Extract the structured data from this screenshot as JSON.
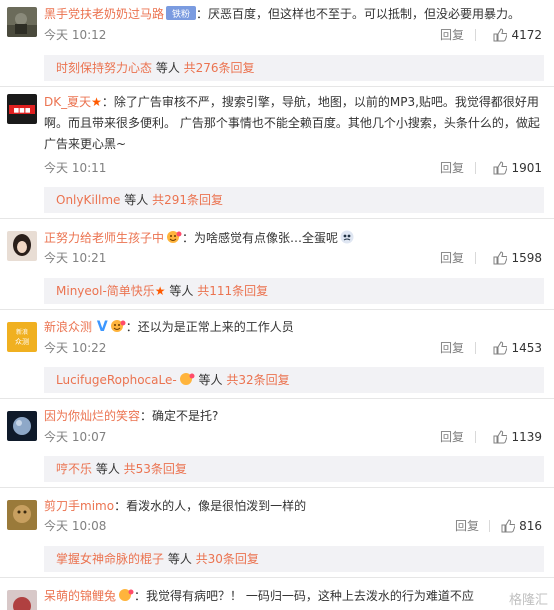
{
  "accent_color": "#eb7350",
  "comments": [
    {
      "username": "黑手党扶老奶奶过马路",
      "badge": "铁粉",
      "text": "：厌恶百度，但这样也不至于。可以抵制，但没必要用暴力。",
      "time": "今天 10:12",
      "reply_label": "回复",
      "likes": "4172",
      "sub_user": "时刻保持努力心态",
      "sub_mid": " 等人 ",
      "sub_total": "共276条回复"
    },
    {
      "username": "DK_夏天",
      "text": "：除了广告审核不严，搜索引擎，导航，地图，以前的MP3,贴吧。我觉得都很好用啊。而且带来很多便利。 广告那个事情也不能全赖百度。其他几个小搜索，头条什么的，做起广告来更心黑~",
      "time": "今天 10:11",
      "reply_label": "回复",
      "likes": "1901",
      "sub_user": "OnlyKillme",
      "sub_mid": " 等人 ",
      "sub_total": "共291条回复"
    },
    {
      "username": "正努力给老师生孩子中",
      "text": "：为啥感觉有点像张…全蛋呢",
      "time": "今天 10:21",
      "reply_label": "回复",
      "likes": "1598",
      "sub_user": "Minyeol-简单快乐",
      "sub_mid": " 等人 ",
      "sub_total": "共111条回复"
    },
    {
      "username": "新浪众测",
      "text": "：还以为是正常上来的工作人员",
      "time": "今天 10:22",
      "reply_label": "回复",
      "likes": "1453",
      "sub_user": "LucifugeRophocaLe-",
      "sub_mid": " 等人 ",
      "sub_total": "共32条回复"
    },
    {
      "username": "因为你灿烂的笑容",
      "text": "：确定不是托?",
      "time": "今天 10:07",
      "reply_label": "回复",
      "likes": "1139",
      "sub_user": "哼不乐",
      "sub_mid": " 等人 ",
      "sub_total": "共53条回复"
    },
    {
      "username": "剪刀手mimo",
      "text": "：看泼水的人，像是很怕泼到一样的",
      "time": "今天 10:08",
      "reply_label": "回复",
      "likes": "816",
      "sub_user": "掌握女神命脉的棍子",
      "sub_mid": " 等人 ",
      "sub_total": "共30条回复"
    },
    {
      "username": "呆萌的锦鲤兔",
      "text": "：我觉得有病吧？！ 一码归一码，这种上去泼水的行为难道不应该拘留？",
      "time": "",
      "reply_label": "",
      "likes": "",
      "sub_user": "",
      "sub_mid": "",
      "sub_total": ""
    }
  ],
  "watermark": "格隆汇"
}
